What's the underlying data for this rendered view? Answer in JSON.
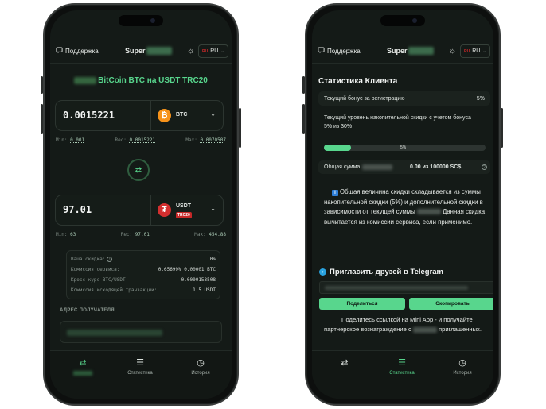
{
  "header": {
    "support_label": "Поддержка",
    "brand_prefix": "Super",
    "lang_flag": "RU",
    "lang_label": "RU"
  },
  "exchange": {
    "pair_title": "BitCoin BTC на USDT TRC20",
    "from": {
      "amount": "0.0015221",
      "ticker": "BTC",
      "icon": "bitcoin-icon",
      "min_label": "Min:",
      "min_value": "0.001",
      "rec_label": "Rec:",
      "rec_value": "0.0015221",
      "max_label": "Max:",
      "max_value": "0.0070507"
    },
    "to": {
      "amount": "97.01",
      "ticker": "USDT",
      "network_tag": "TRC20",
      "icon": "tether-icon",
      "min_label": "Min:",
      "min_value": "63",
      "rec_label": "Rec:",
      "rec_value": "97.01",
      "max_label": "Max:",
      "max_value": "454.88"
    },
    "info_rows": [
      {
        "label": "Ваша скидка:",
        "value": "0%"
      },
      {
        "label": "Комиссия сервиса:",
        "value": "0.65699%  0.00001 BTC"
      },
      {
        "label": "Кросс-курс BTC/USDT:",
        "value": "0.0000153508"
      },
      {
        "label": "Комиссия исходящей транзакции:",
        "value": "1.5 USDT"
      }
    ],
    "address_label": "АДРЕС ПОЛУЧАТЕЛЯ"
  },
  "nav": {
    "items": [
      {
        "label": "",
        "icon": "swap-icon"
      },
      {
        "label": "Статистика",
        "icon": "list-icon"
      },
      {
        "label": "История",
        "icon": "clock-icon"
      }
    ]
  },
  "stats": {
    "title": "Статистика Клиента",
    "registration_bonus_label": "Текущий бонус за регистрацию",
    "registration_bonus_value": "5%",
    "cumulative_label": "Текущий уровень накопительной скидки с учетом бонуса",
    "cumulative_progress_text": "5% из 30%",
    "cumulative_progress_fraction": 0.1667,
    "cumulative_bar_label": "5%",
    "total_label": "Общая сумма",
    "total_value": "0.00 из 100000 SC$",
    "note_part1": "Общая величина скидки складывается из суммы накопительной скидки (5%) и дополнительной скидки в зависимости от текущей суммы",
    "note_part2": "Данная скидка вычитается из комиссии сервиса, если применимо."
  },
  "invite": {
    "title": "Пригласить друзей в Telegram",
    "share_button": "Поделиться",
    "copy_button": "Скопировать",
    "note_part1": "Поделитесь ссылкой на Mini App - и получайте партнерское вознаграждение с",
    "note_part2": "приглашенных."
  },
  "colors": {
    "accent": "#58d68d",
    "background": "#141a17",
    "bitcoin": "#f7931a",
    "tether": "#d32f2f"
  }
}
